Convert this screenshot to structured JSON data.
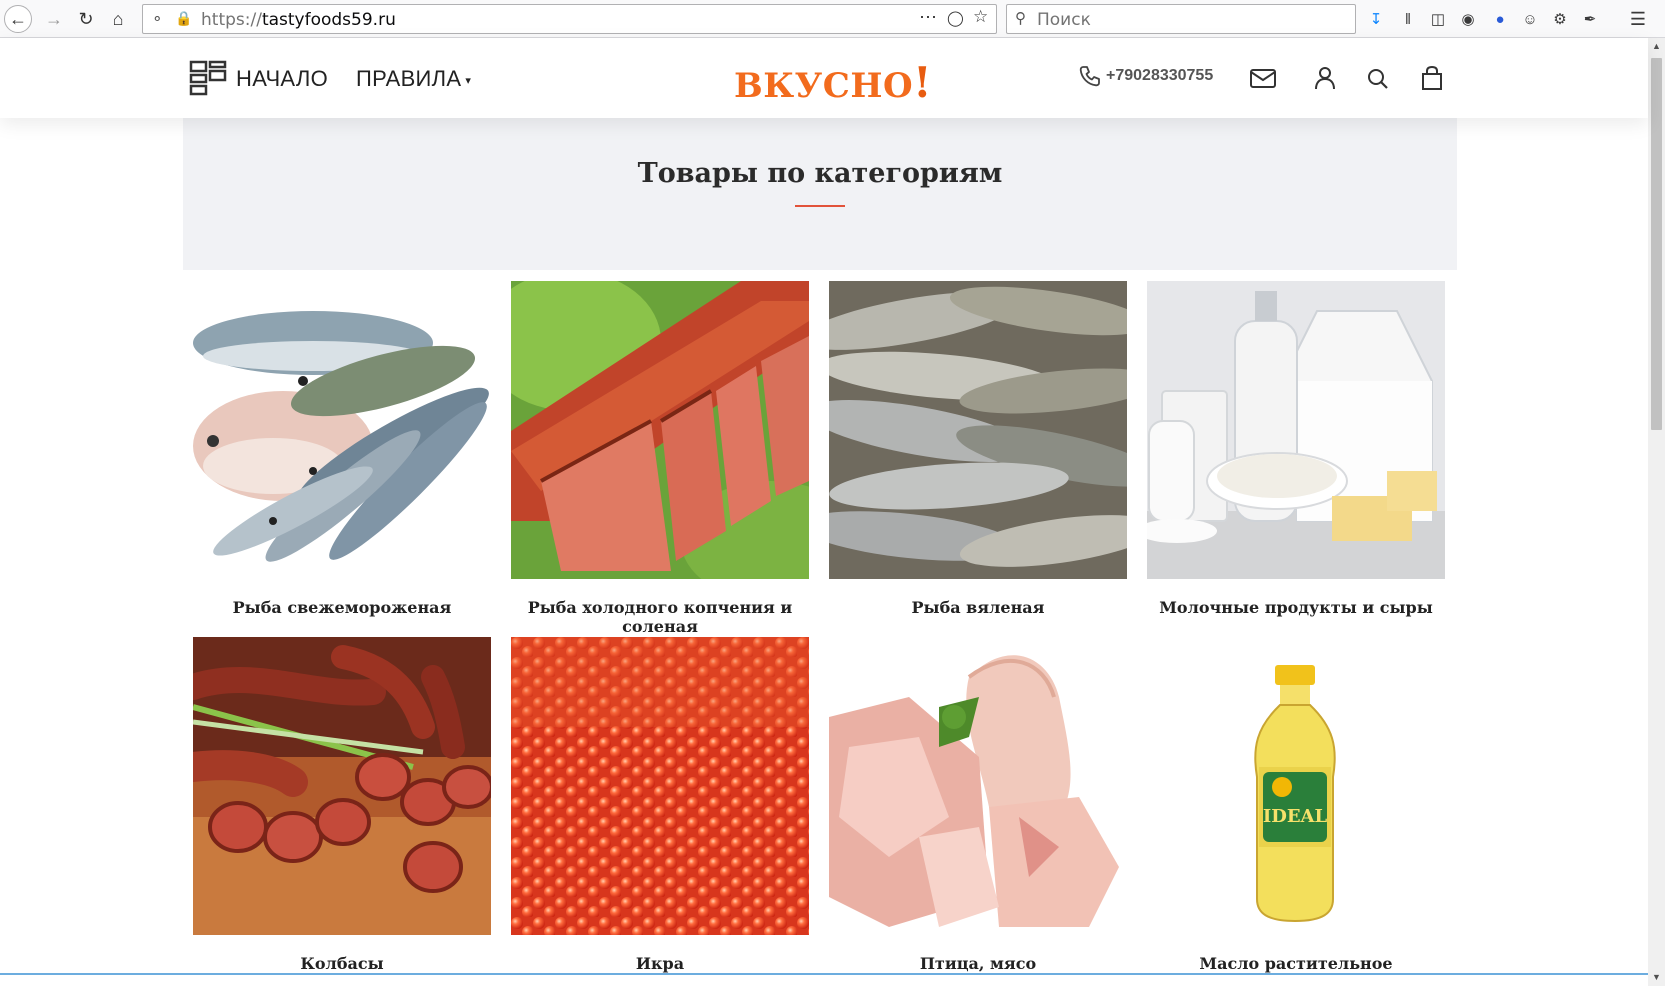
{
  "browser": {
    "url_protocol": "https://",
    "url_host": "tastyfoods59.ru",
    "search_placeholder": "Поиск",
    "icons": [
      "back-icon",
      "forward-icon",
      "reload-icon",
      "home-icon",
      "shield-icon",
      "lock-icon",
      "more-icon",
      "pocket-icon",
      "bookmark-star-icon",
      "download-icon",
      "library-icon",
      "sidebar-icon",
      "extension-icon",
      "globe-icon",
      "account-icon",
      "settings-gear-icon",
      "eyedropper-icon",
      "hamburger-menu-icon"
    ]
  },
  "header": {
    "nav_home": "НАЧАЛО",
    "nav_rules": "ПРАВИЛА",
    "logo_text": "ВКУСНО",
    "logo_bang": "!",
    "phone": "+79028330755",
    "accent_color": "#f26b1d"
  },
  "section": {
    "title": "Товары по категориям",
    "underline_color": "#e2533a"
  },
  "categories": [
    {
      "label": "Рыба свежемороженая",
      "image": "frozen-fish-image"
    },
    {
      "label": "Рыба холодного копчения и соленая",
      "image": "smoked-salmon-image"
    },
    {
      "label": "Рыба вяленая",
      "image": "dried-fish-image"
    },
    {
      "label": "Молочные продукты и сыры",
      "image": "dairy-image"
    },
    {
      "label": "Колбасы",
      "image": "sausages-image"
    },
    {
      "label": "Икра",
      "image": "caviar-image"
    },
    {
      "label": "Птица, мясо",
      "image": "poultry-meat-image"
    },
    {
      "label": "Масло растительное",
      "image": "vegetable-oil-image",
      "brand_text": "IDEAL"
    }
  ]
}
